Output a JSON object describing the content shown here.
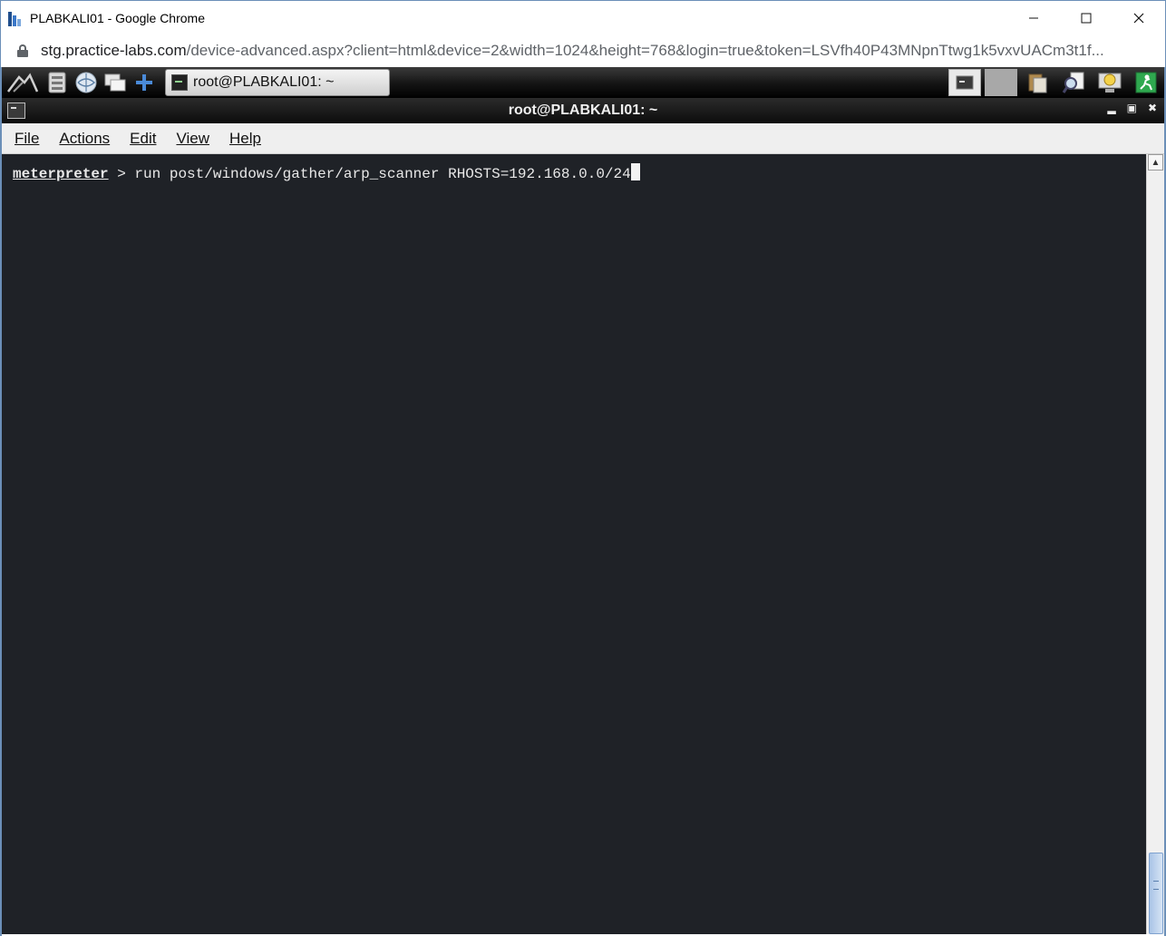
{
  "browser": {
    "title": "PLABKALI01 - Google Chrome",
    "url_host": "stg.practice-labs.com",
    "url_path": "/device-advanced.aspx?client=html&device=2&width=1024&height=768&login=true&token=LSVfh40P43MNpnTtwg1k5vxvUACm3t1f..."
  },
  "taskbar": {
    "task_label": "root@PLABKALI01: ~"
  },
  "terminal_window": {
    "title": "root@PLABKALI01: ~",
    "menu": [
      {
        "label": "File"
      },
      {
        "label": "Actions"
      },
      {
        "label": "Edit"
      },
      {
        "label": "View"
      },
      {
        "label": "Help"
      }
    ],
    "prompt": "meterpreter",
    "command": " > run post/windows/gather/arp_scanner RHOSTS=192.168.0.0/24"
  }
}
